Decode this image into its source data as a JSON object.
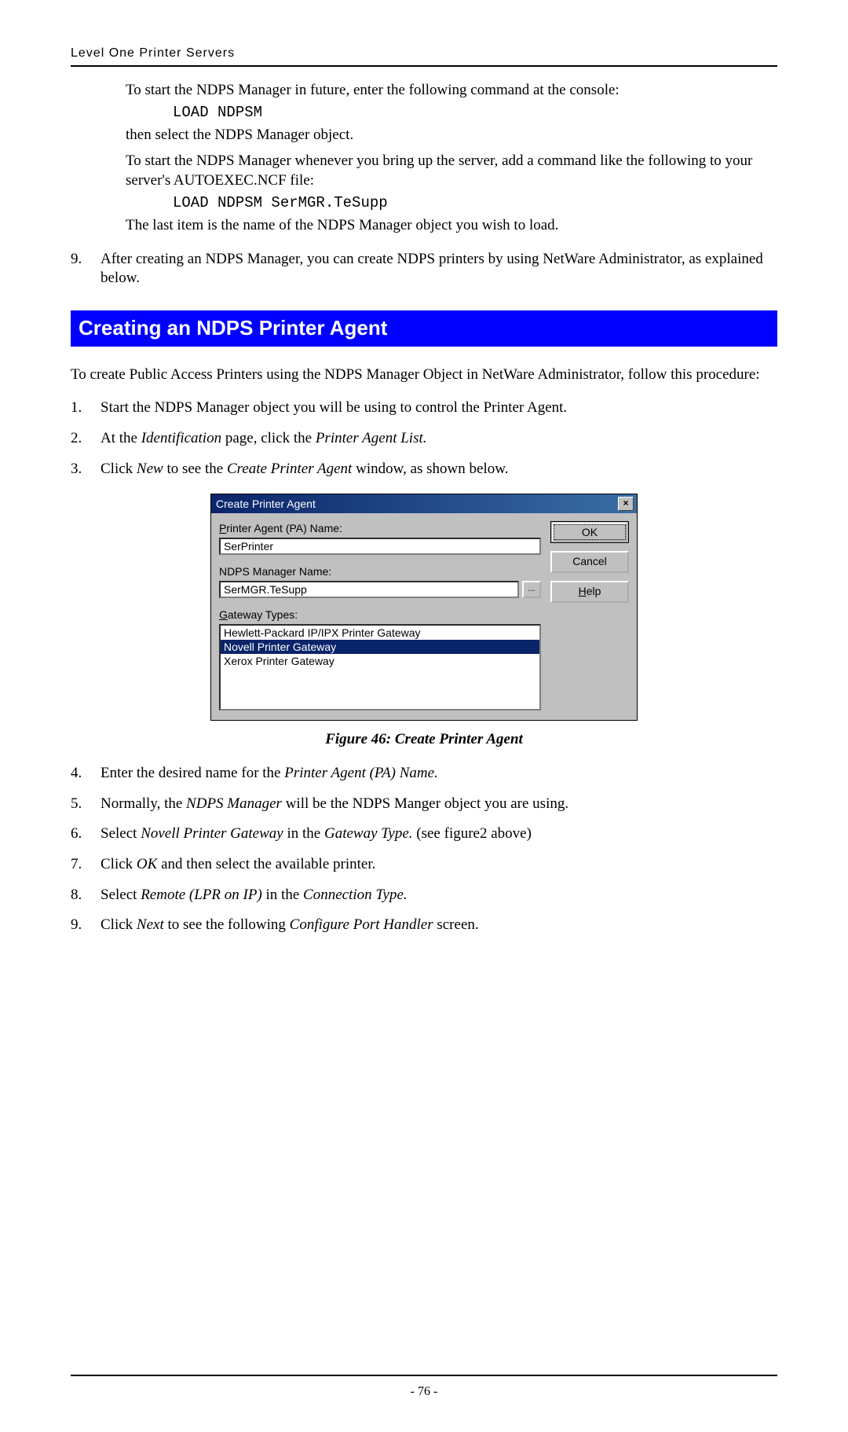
{
  "header": {
    "title": "Level One Printer Servers"
  },
  "top": {
    "p1": "To start the NDPS Manager in future, enter the following command at the console:",
    "cmd1": "LOAD NDPSM",
    "p2": "then select the NDPS Manager object.",
    "p3": "To start the NDPS Manager whenever you bring up the server, add a command like the following to your server's AUTOEXEC.NCF file:",
    "cmd2": "LOAD  NDPSM  SerMGR.TeSupp",
    "p4": "The last item is the name of the NDPS Manager object you wish to load.",
    "step9_num": "9.",
    "step9_text": "After creating an NDPS Manager, you can create NDPS printers by using NetWare Administrator, as explained below."
  },
  "section_heading": "Creating an NDPS Printer Agent",
  "intro": "To create Public Access Printers using the NDPS Manager Object in NetWare Administrator, follow this procedure:",
  "steps_a": [
    {
      "num": "1.",
      "text": "Start the NDPS Manager object you will be using to control the Printer Agent."
    },
    {
      "num": "2.",
      "pre": "At the ",
      "it1": "Identification",
      "mid": " page, click the ",
      "it2": "Printer Agent List.",
      "post": ""
    },
    {
      "num": "3.",
      "pre": "Click ",
      "it1": "New",
      "mid": " to see the ",
      "it2": "Create Printer Agent",
      "post": " window, as shown below."
    }
  ],
  "dialog": {
    "title": "Create Printer Agent",
    "close": "×",
    "pa_label_u": "P",
    "pa_label_rest": "rinter Agent (PA) Name:",
    "pa_value": "SerPrinter",
    "mgr_label": "NDPS Manager Name:",
    "mgr_value": "SerMGR.TeSupp",
    "browse": "...",
    "gw_label_u": "G",
    "gw_label_rest": "ateway Types:",
    "opts": [
      "Hewlett-Packard IP/IPX Printer Gateway",
      "Novell Printer Gateway",
      "Xerox Printer Gateway"
    ],
    "selected_index": 1,
    "ok": "OK",
    "cancel": "Cancel",
    "help_u": "H",
    "help_rest": "elp"
  },
  "figure_caption": "Figure 46: Create Printer Agent",
  "steps_b": [
    {
      "num": "4.",
      "pre": "Enter the desired name for the ",
      "it1": "Printer Agent (PA) Name.",
      "mid": "",
      "it2": "",
      "post": ""
    },
    {
      "num": "5.",
      "pre": "Normally, the ",
      "it1": "NDPS Manager",
      "mid": " will be the NDPS Manger object you are using.",
      "it2": "",
      "post": ""
    },
    {
      "num": "6.",
      "pre": "Select ",
      "it1": "Novell Printer Gateway",
      "mid": " in the ",
      "it2": "Gateway Type.",
      "post": " (see figure2 above)"
    },
    {
      "num": "7.",
      "pre": "Click ",
      "it1": "OK",
      "mid": " and then select the available printer.",
      "it2": "",
      "post": ""
    },
    {
      "num": "8.",
      "pre": "Select ",
      "it1": "Remote (LPR on IP)",
      "mid": " in the ",
      "it2": "Connection Type.",
      "post": ""
    },
    {
      "num": "9.",
      "pre": "Click ",
      "it1": "Next",
      "mid": " to see the following ",
      "it2": "Configure Port Handler",
      "post": " screen."
    }
  ],
  "footer": {
    "page": "- 76 -"
  }
}
